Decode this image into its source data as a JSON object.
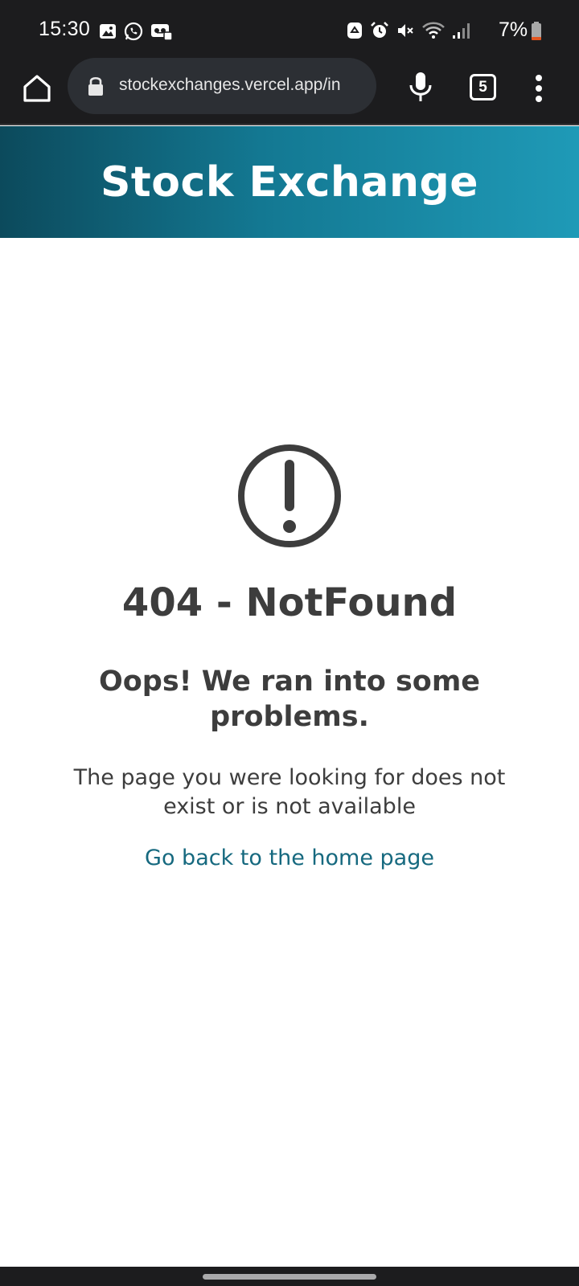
{
  "status_bar": {
    "time": "15:30",
    "battery_percent": "7%",
    "battery_level": 0.07,
    "left_icons": [
      "gallery-icon",
      "whatsapp-icon",
      "voicemail-icon"
    ],
    "right_icons": [
      "recycle-icon",
      "alarm-icon",
      "mute-icon",
      "wifi-icon",
      "signal-icon"
    ]
  },
  "browser": {
    "url": "stockexchanges.vercel.app/in",
    "tab_count": "5"
  },
  "header": {
    "title": "Stock Exchange"
  },
  "error": {
    "code": "404 - NotFound",
    "headline": "Oops! We ran into some problems.",
    "message": "The page you were looking for does not exist or is not available",
    "link_text": "Go back to the home page"
  },
  "colors": {
    "header_gradient_start": "#0c4a5c",
    "header_gradient_end": "#1f9ab7",
    "text": "#3d3d3d",
    "link": "#16697f",
    "system_bar": "#1c1c1e"
  }
}
